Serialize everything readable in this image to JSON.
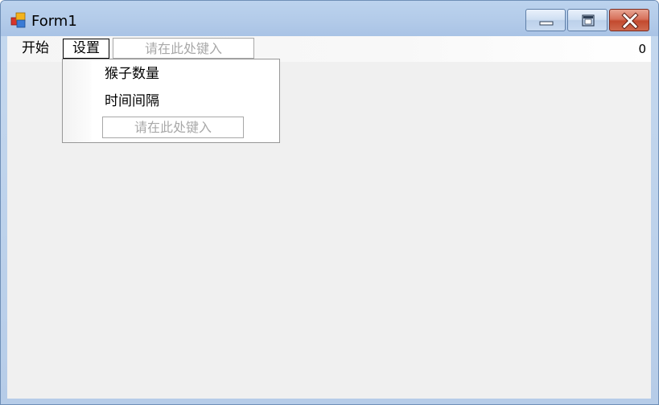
{
  "window": {
    "title": "Form1",
    "icon": "app-form-icon",
    "buttons": {
      "minimize": "minimize-icon",
      "maximize": "maximize-icon",
      "close": "close-icon"
    }
  },
  "menubar": {
    "items": [
      {
        "label": "开始"
      },
      {
        "label": "设置",
        "selected": true
      }
    ],
    "input_placeholder": "请在此处键入",
    "counter": "0"
  },
  "dropdown": {
    "items": [
      {
        "label": "猴子数量"
      },
      {
        "label": "时间间隔"
      }
    ],
    "input_placeholder": "请在此处键入"
  },
  "colors": {
    "titlebar": "#b3cbe9",
    "client": "#f0f0f0",
    "close_button": "#c34a2f"
  }
}
